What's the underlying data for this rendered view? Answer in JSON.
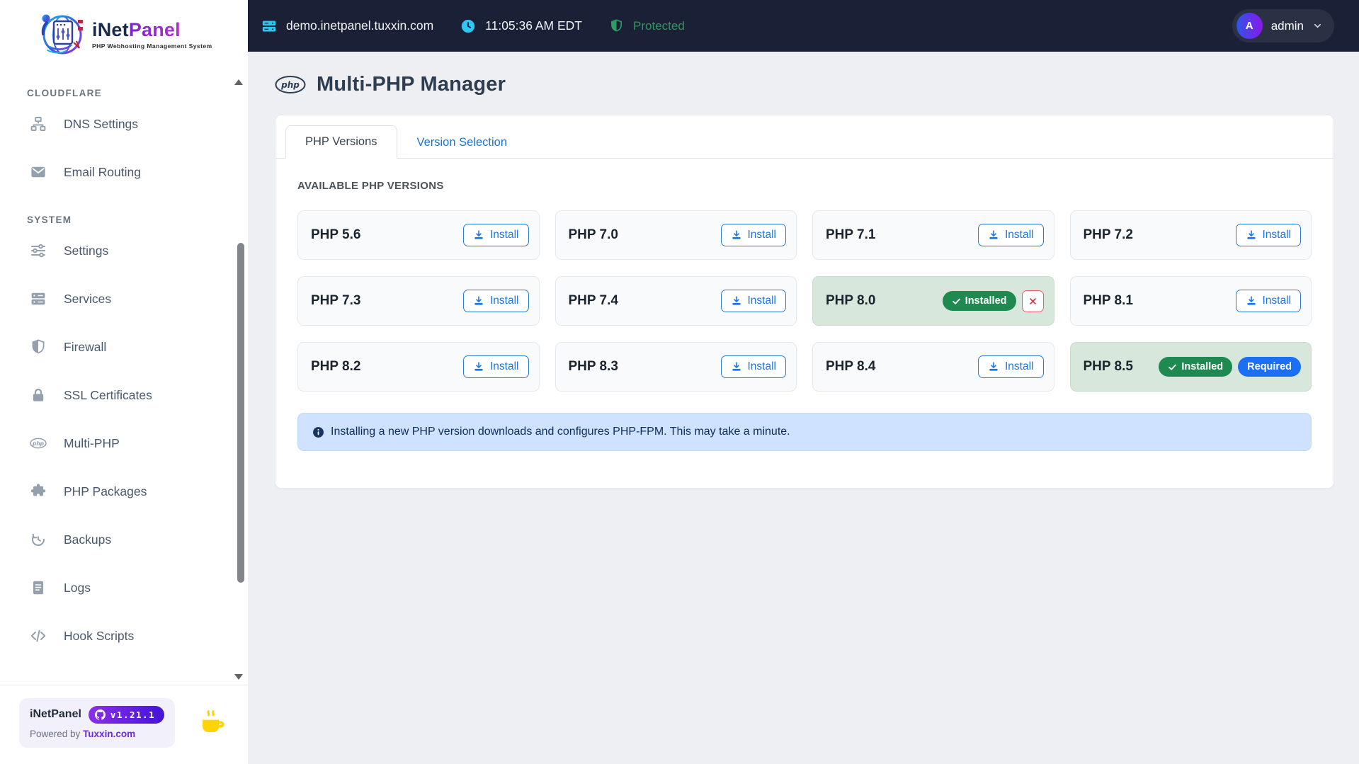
{
  "branding": {
    "logo_text_primary": "iNet",
    "logo_text_secondary": "Panel",
    "tagline": "PHP Webhosting Management System"
  },
  "topbar": {
    "domain": "demo.inetpanel.tuxxin.com",
    "time": "11:05:36 AM EDT",
    "protected_label": "Protected",
    "user": {
      "avatar_initial": "A",
      "name": "admin"
    }
  },
  "sidebar": {
    "sections": [
      {
        "title": "CLOUDFLARE",
        "items": [
          {
            "icon": "sitemap-icon",
            "label": "DNS Settings"
          },
          {
            "icon": "envelope-icon",
            "label": "Email Routing"
          }
        ]
      },
      {
        "title": "SYSTEM",
        "items": [
          {
            "icon": "sliders-icon",
            "label": "Settings"
          },
          {
            "icon": "server-stack-icon",
            "label": "Services"
          },
          {
            "icon": "shield-icon",
            "label": "Firewall"
          },
          {
            "icon": "lock-icon",
            "label": "SSL Certificates"
          },
          {
            "icon": "php-badge-icon",
            "label": "Multi-PHP"
          },
          {
            "icon": "puzzle-icon",
            "label": "PHP Packages"
          },
          {
            "icon": "history-icon",
            "label": "Backups"
          },
          {
            "icon": "file-lines-icon",
            "label": "Logs"
          },
          {
            "icon": "code-icon",
            "label": "Hook Scripts"
          }
        ]
      }
    ],
    "footer": {
      "app_name": "iNetPanel",
      "version_badge": "v1.21.1",
      "powered_by_prefix": "Powered by",
      "powered_by_link": "Tuxxin.com"
    }
  },
  "main": {
    "page_title": "Multi-PHP Manager",
    "tabs": [
      {
        "label": "PHP Versions",
        "active": true
      },
      {
        "label": "Version Selection",
        "active": false
      }
    ],
    "section_heading": "AVAILABLE PHP VERSIONS",
    "labels": {
      "install": "Install",
      "installed": "Installed",
      "required": "Required"
    },
    "versions": [
      {
        "name": "PHP 5.6",
        "installed": false
      },
      {
        "name": "PHP 7.0",
        "installed": false
      },
      {
        "name": "PHP 7.1",
        "installed": false
      },
      {
        "name": "PHP 7.2",
        "installed": false
      },
      {
        "name": "PHP 7.3",
        "installed": false
      },
      {
        "name": "PHP 7.4",
        "installed": false
      },
      {
        "name": "PHP 8.0",
        "installed": true,
        "removable": true
      },
      {
        "name": "PHP 8.1",
        "installed": false
      },
      {
        "name": "PHP 8.2",
        "installed": false
      },
      {
        "name": "PHP 8.3",
        "installed": false
      },
      {
        "name": "PHP 8.4",
        "installed": false
      },
      {
        "name": "PHP 8.5",
        "installed": true,
        "required": true
      }
    ],
    "info_message": "Installing a new PHP version downloads and configures PHP-FPM. This may take a minute."
  },
  "colors": {
    "topbar_bg": "#1a2137",
    "accent_cyan": "#2ec6f2",
    "protected_green": "#2e9d63",
    "link_blue": "#1b74d2",
    "install_blue": "#1b74e8",
    "installed_card_bg": "#d8e7db",
    "badge_green": "#1e8a4f",
    "badge_blue": "#1b6ff5",
    "danger_red": "#d63343",
    "alert_bg": "#cfe2ff",
    "alert_text": "#0d2d5e",
    "brand_purple": "#6d28d9",
    "coffee_yellow": "#ffd400"
  }
}
